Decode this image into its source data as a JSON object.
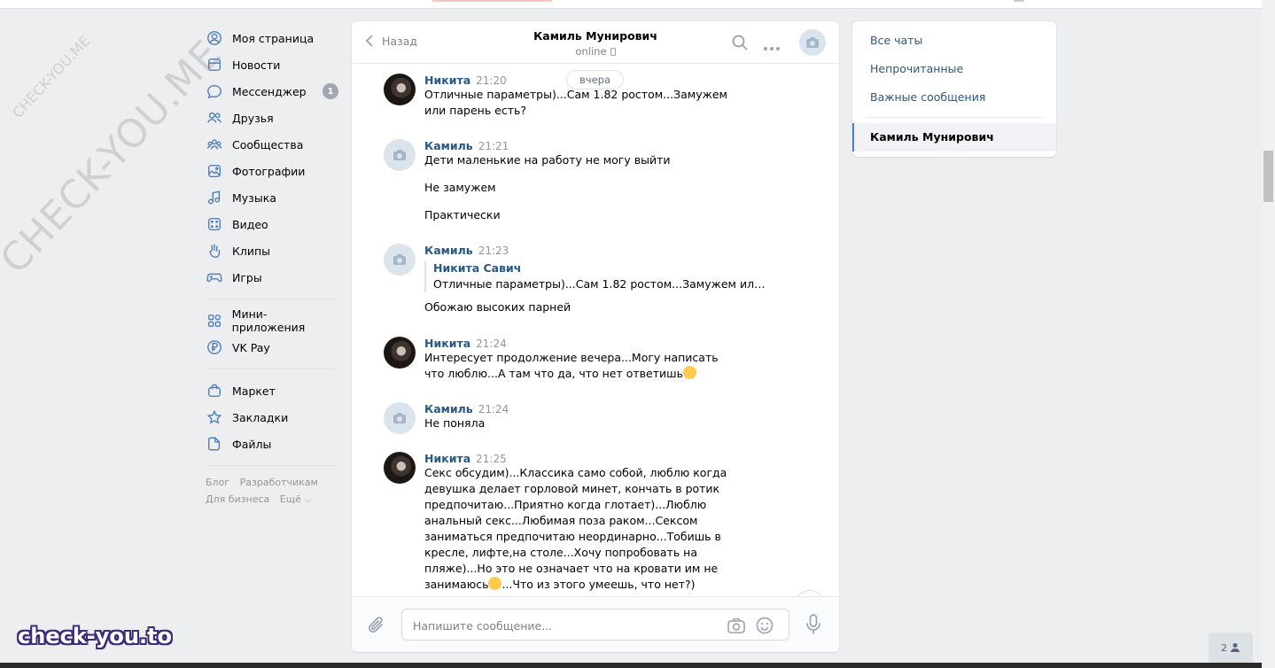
{
  "watermark": {
    "small": "CHECK-YOU.ME",
    "large": "CHECK-YOU.ME",
    "logo": "check-you.to"
  },
  "nav": {
    "items": [
      {
        "label": "Моя страница",
        "icon": "profile-icon"
      },
      {
        "label": "Новости",
        "icon": "news-icon"
      },
      {
        "label": "Мессенджер",
        "icon": "messenger-icon",
        "count": "1"
      },
      {
        "label": "Друзья",
        "icon": "friends-icon"
      },
      {
        "label": "Сообщества",
        "icon": "communities-icon"
      },
      {
        "label": "Фотографии",
        "icon": "photos-icon"
      },
      {
        "label": "Музыка",
        "icon": "music-icon"
      },
      {
        "label": "Видео",
        "icon": "video-icon"
      },
      {
        "label": "Клипы",
        "icon": "clips-icon"
      },
      {
        "label": "Игры",
        "icon": "games-icon"
      }
    ],
    "items2": [
      {
        "label": "Мини-приложения",
        "icon": "mini-apps-icon"
      },
      {
        "label": "VK Pay",
        "icon": "vkpay-icon"
      }
    ],
    "items3": [
      {
        "label": "Маркет",
        "icon": "market-icon"
      },
      {
        "label": "Закладки",
        "icon": "bookmarks-icon"
      },
      {
        "label": "Файлы",
        "icon": "files-icon"
      }
    ],
    "footer": {
      "blog": "Блог",
      "dev": "Разработчикам",
      "business": "Для бизнеса",
      "more": "Ещё ⌵"
    }
  },
  "chat": {
    "back_label": "Назад",
    "title": "Камиль Мунирович",
    "status": "online",
    "date_pill": "вчера",
    "messages": [
      {
        "author": "Никита",
        "time": "21:20",
        "avatar": "photo",
        "text": [
          "Отличные параметры)...Сам 1.82 ростом...Замужем или парень есть?"
        ]
      },
      {
        "author": "Камиль",
        "time": "21:21",
        "avatar": "empty",
        "text": [
          "Дети маленькие на работу не могу выйти",
          "Не замужем",
          "Практически"
        ]
      },
      {
        "author": "Камиль",
        "time": "21:23",
        "avatar": "empty",
        "fwd_author": "Никита Савич",
        "fwd_text": "Отличные параметры)...Сам 1.82 ростом...Замужем или пар...",
        "text": [
          "Обожаю высоких парней"
        ]
      },
      {
        "author": "Никита",
        "time": "21:24",
        "avatar": "photo",
        "text": [
          "Интересует продолжение вечера...Могу написать что люблю...А там что да, что нет ответишь"
        ]
      },
      {
        "author": "Камиль",
        "time": "21:24",
        "avatar": "empty",
        "text": [
          "Не поняла"
        ]
      },
      {
        "author": "Никита",
        "time": "21:25",
        "avatar": "photo",
        "text_a": "Секс обсудим)...Классика само собой, люблю когда девушка делает горловой минет, кончать в ротик предпочитаю...Приятно когда глотает)...Люблю анальный секс...Любимая поза раком...Сексом заниматься предпочитаю неординарно...Тобишь в кресле, лифте,на столе...Хочу попробовать на пляже)...Но это не означает что на кровати им не занимаюсь",
        "text_b": "...Что из этого умеешь, что нет?)"
      }
    ],
    "composer_placeholder": "Напишите сообщение..."
  },
  "right": {
    "all_chats": "Все чаты",
    "unread": "Непрочитанные",
    "important": "Важные сообщения",
    "active_chat": "Камиль Мунирович"
  },
  "online_count": "2"
}
